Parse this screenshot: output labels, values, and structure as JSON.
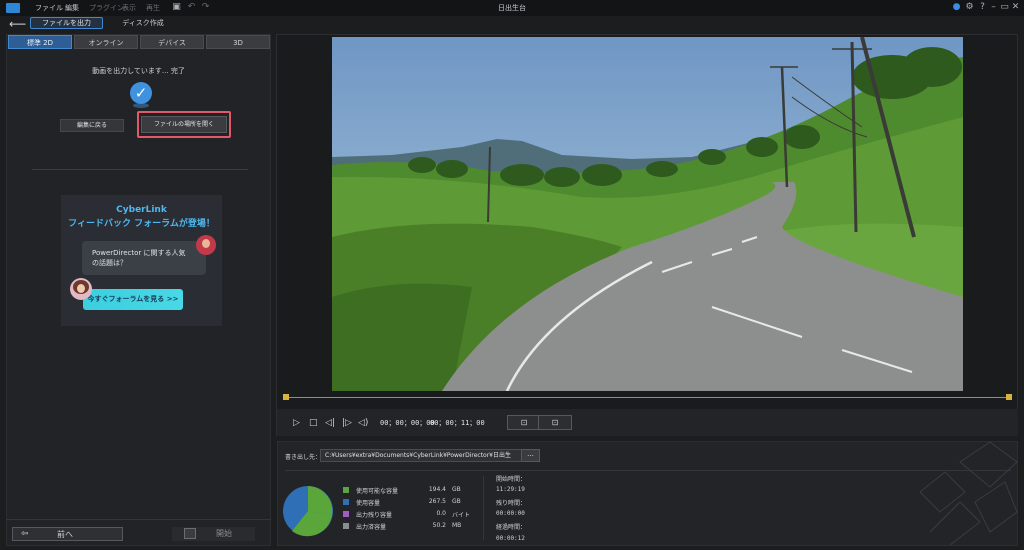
{
  "menubar": {
    "items": [
      {
        "label": "ファイル",
        "enabled": true
      },
      {
        "label": "編集",
        "enabled": true
      },
      {
        "label": "プラグイン",
        "enabled": false
      },
      {
        "label": "表示",
        "enabled": false
      },
      {
        "label": "再生",
        "enabled": false
      }
    ],
    "window_title": "日出生台"
  },
  "mode_tabs": {
    "export": "ファイルを出力",
    "disc": "ディスク作成"
  },
  "format_tabs": [
    "標準 2D",
    "オンライン",
    "デバイス",
    "3D"
  ],
  "status": {
    "text": "動画を出力しています... 完了"
  },
  "actions": {
    "back_to_edit": "編集に戻る",
    "open_location": "ファイルの場所を開く"
  },
  "banner": {
    "title_line1": "CyberLink",
    "title_line2": "フィードバック フォーラムが登場！",
    "bubble_line1": "PowerDirector に関する人気",
    "bubble_line2": "の話題は？",
    "cta": "今すぐフォーラムを見る >>"
  },
  "nav": {
    "prev": "前へ",
    "start": "開始"
  },
  "player": {
    "current_time": "00；00；00；00",
    "duration": "00；00；11；00"
  },
  "output": {
    "label": "書き出し先：",
    "path": "C:¥Users¥extra¥Documents¥CyberLink¥PowerDirector¥日出生",
    "browse": "..."
  },
  "storage": [
    {
      "label": "使用可能な容量",
      "value": "194.4",
      "unit": "GB",
      "color": "#5aa63a"
    },
    {
      "label": "使用容量",
      "value": "267.5",
      "unit": "GB",
      "color": "#2f6fb5"
    },
    {
      "label": "出力残り容量",
      "value": "0.0",
      "unit": "バイト",
      "color": "#a05cc0"
    },
    {
      "label": "出力済容量",
      "value": "50.2",
      "unit": "MB",
      "color": "#8a8d92"
    }
  ],
  "times": {
    "start_label": "開始時間：",
    "start_value": "11:29:19",
    "remaining_label": "残り時間：",
    "remaining_value": "00:00:00",
    "elapsed_label": "経過時間：",
    "elapsed_value": "00:00:12"
  }
}
